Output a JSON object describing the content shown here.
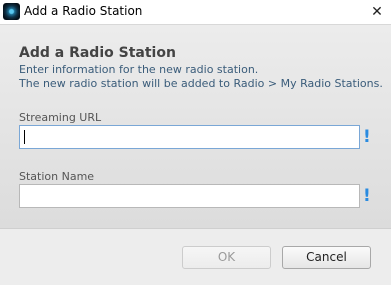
{
  "window": {
    "title": "Add a Radio Station",
    "app_icon": "radio-app-icon",
    "close_glyph": "✕"
  },
  "dialog": {
    "heading": "Add a Radio Station",
    "description_line1": "Enter information for the new radio station.",
    "description_line2": "The new radio station will be added to Radio > My Radio Stations."
  },
  "fields": {
    "streaming_url": {
      "label": "Streaming URL",
      "value": "",
      "required_marker": "!"
    },
    "station_name": {
      "label": "Station Name",
      "value": "",
      "required_marker": "!"
    }
  },
  "buttons": {
    "ok": {
      "label": "OK",
      "enabled": false
    },
    "cancel": {
      "label": "Cancel",
      "enabled": true
    }
  },
  "colors": {
    "required_marker": "#2a8be0",
    "description_text": "#3a5c7a"
  }
}
